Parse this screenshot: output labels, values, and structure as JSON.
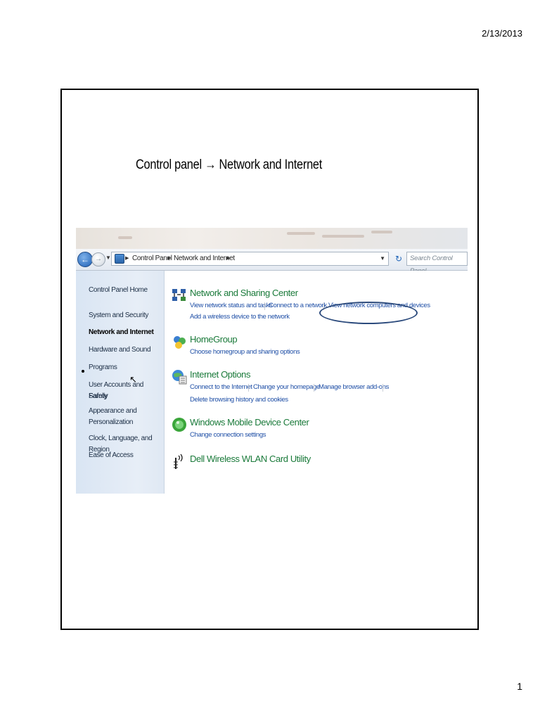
{
  "page": {
    "date": "2/13/2013",
    "number": "1"
  },
  "slide": {
    "title": "Control panel → Network and Internet"
  },
  "explorer": {
    "breadcrumb": [
      "Control Panel",
      "Network and Internet"
    ],
    "search_placeholder": "Search Control Panel",
    "icons": {
      "back": "back-arrow-icon",
      "forward": "forward-arrow-icon",
      "refresh": "refresh-icon",
      "control_panel": "control-panel-icon"
    }
  },
  "sidebar": {
    "items": [
      {
        "label": "Control Panel Home"
      },
      {
        "label": "System and Security"
      },
      {
        "label": "Network and Internet",
        "active": true
      },
      {
        "label": "Hardware and Sound"
      },
      {
        "label": "Programs"
      },
      {
        "label": "User Accounts and Family"
      },
      {
        "label": "Safety"
      },
      {
        "label": "Appearance and"
      },
      {
        "label": "Personalization"
      },
      {
        "label": "Clock, Language, and Region"
      },
      {
        "label": "Ease of Access"
      }
    ]
  },
  "categories": [
    {
      "title": "Network and Sharing Center",
      "icon": "network-sharing-icon",
      "links": [
        "View network status and tasks",
        "Connect to a network",
        "View network computers and devices",
        "Add a wireless device to the network"
      ]
    },
    {
      "title": "HomeGroup",
      "icon": "homegroup-icon",
      "links": [
        "Choose homegroup and sharing options"
      ]
    },
    {
      "title": "Internet Options",
      "icon": "internet-options-icon",
      "links": [
        "Connect to the Internet",
        "Change your homepage",
        "Manage browser add-ons",
        "Delete browsing history and cookies"
      ]
    },
    {
      "title": "Windows Mobile Device Center",
      "icon": "mobile-device-center-icon",
      "links": [
        "Change connection settings"
      ]
    },
    {
      "title": "Dell Wireless WLAN Card Utility",
      "icon": "wireless-antenna-icon",
      "links": []
    }
  ],
  "colors": {
    "link": "#1f4fa6",
    "category_title": "#1a7a3a",
    "annotation": "#2b4a7c"
  }
}
